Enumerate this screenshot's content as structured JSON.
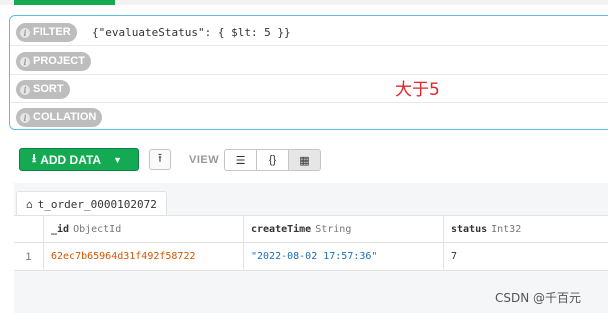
{
  "query_bar": {
    "filter_label": "FILTER",
    "filter_value": "{\"evaluateStatus\": { $lt: 5 }}",
    "project_label": "PROJECT",
    "sort_label": "SORT",
    "collation_label": "COLLATION",
    "annotation": "大于5"
  },
  "toolbar": {
    "add_data_label": "ADD DATA",
    "view_label": "VIEW",
    "view_json_label": "{}"
  },
  "tab": {
    "name": "t_order_0000102072"
  },
  "grid": {
    "columns": [
      {
        "name": "_id",
        "type": "ObjectId"
      },
      {
        "name": "createTime",
        "type": "String"
      },
      {
        "name": "status",
        "type": "Int32"
      }
    ],
    "rows": [
      {
        "index": "1",
        "id": "62ec7b65964d31f492f58722",
        "createTime": "\"2022-08-02 17:57:36\"",
        "status": "7"
      }
    ]
  },
  "watermark": "CSDN @千百元",
  "colors": {
    "accent": "#13aa52",
    "query_border": "#5bc0de",
    "annotation": "#e0242b",
    "objectid": "#d55400",
    "string": "#1c70b5"
  }
}
